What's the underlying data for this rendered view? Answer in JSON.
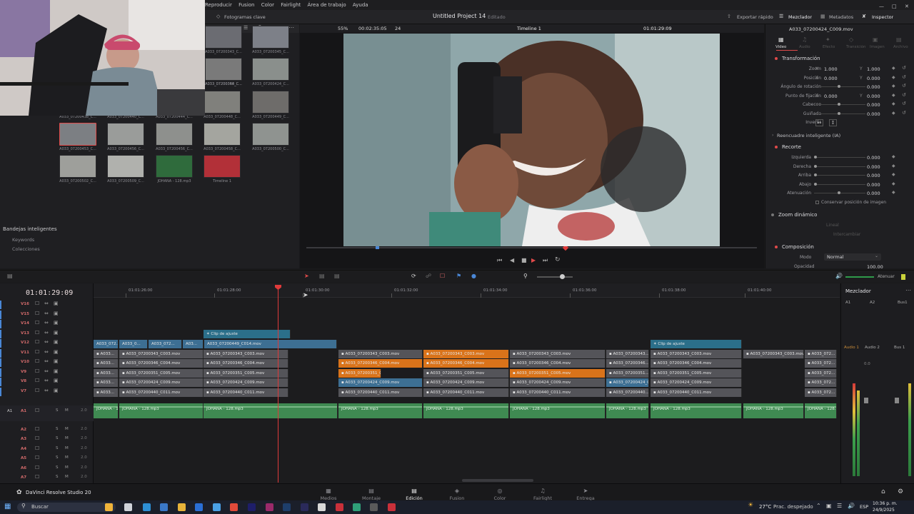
{
  "menu": {
    "items": [
      "Reproducir",
      "Fusion",
      "Color",
      "Fairlight",
      "Área de trabajo",
      "Ayuda"
    ]
  },
  "toolbar": {
    "keyframes_label": "Fotogramas clave",
    "project_title": "Untitled Project 14",
    "project_status": "Editado",
    "quick_export": "Exportar rápido",
    "mixer": "Mezclador",
    "metadata": "Metadatos",
    "inspector": "Inspector"
  },
  "viewer": {
    "zoom": "55%",
    "timecode_in": "00:02:35:05",
    "frame_rate": "24",
    "timeline_name": "Timeline 1",
    "timecode_out": "01:01:29:09"
  },
  "media_pool": {
    "clips": [
      {
        "label": "A033_07200343_C...",
        "color": "#6b6c72"
      },
      {
        "label": "A033_07200345_C...",
        "color": "#7d8088"
      },
      {
        "label": "A033_07200354_C...",
        "color": "#5e6270"
      },
      {
        "label": "A033_07200348_C...",
        "color": "#7a7a7a"
      },
      {
        "label": "A033_07200424_C...",
        "color": "#8a8f8c"
      },
      {
        "label": "A033_07200438_C...",
        "color": "#777b78"
      },
      {
        "label": "A033_07200440_C...",
        "color": "#85888a"
      },
      {
        "label": "A033_07200444_C...",
        "color": "#6f7171"
      },
      {
        "label": "A033_07200448_C...",
        "color": "#80807c"
      },
      {
        "label": "A033_07200449_C...",
        "color": "#6e6c6a"
      },
      {
        "label": "A033_07200453_C...",
        "color": "#7c7f83"
      },
      {
        "label": "A033_07200456_C...",
        "color": "#9a9c9a"
      },
      {
        "label": "A033_07200456_C...",
        "color": "#8e908d"
      },
      {
        "label": "A033_07200458_C...",
        "color": "#a4a59f"
      },
      {
        "label": "A033_07200500_C...",
        "color": "#8f9390"
      },
      {
        "label": "A033_07200502_C...",
        "color": "#9e9f9b"
      },
      {
        "label": "A033_07200509_C...",
        "color": "#b0b1ad"
      },
      {
        "label": "JOHANA - 128.mp3",
        "color": "#2f6b3c"
      },
      {
        "label": "Timeline 1",
        "color": "#b23038"
      }
    ],
    "smart_bins_title": "Bandejas inteligentes",
    "smart_bins": [
      "Keywords",
      "Colecciones"
    ]
  },
  "inspector": {
    "clip_name": "A033_07200424_C009.mov",
    "tabs": [
      "Video",
      "Audio",
      "Efecto",
      "Transición",
      "Imagen",
      "Archivo"
    ],
    "transform_title": "Transformación",
    "rows": [
      {
        "label": "Zoom",
        "x": "1.000",
        "y": "1.000"
      },
      {
        "label": "Posición",
        "x": "0.000",
        "y": "0.000"
      },
      {
        "label": "Ángulo de rotación",
        "x": "",
        "y": "0.000"
      },
      {
        "label": "Punto de fijación",
        "x": "0.000",
        "y": "0.000"
      },
      {
        "label": "Cabeceo",
        "x": "",
        "y": "0.000"
      },
      {
        "label": "Guiñada",
        "x": "",
        "y": "0.000"
      },
      {
        "label": "Invertir",
        "x": "",
        "y": ""
      }
    ],
    "smart_reframe": "Reencuadre inteligente (IA)",
    "crop_title": "Recorte",
    "crop_rows": [
      {
        "label": "Izquierda",
        "value": "0.000"
      },
      {
        "label": "Derecha",
        "value": "0.000"
      },
      {
        "label": "Arriba",
        "value": "0.000"
      },
      {
        "label": "Abajo",
        "value": "0.000"
      },
      {
        "label": "Atenuación",
        "value": "0.000"
      }
    ],
    "keep_image_position": "Conservar posición de imagen",
    "dynamic_zoom_title": "Zoom dinámico",
    "dynamic_zoom_mode": "Lineal",
    "dynamic_zoom_swap": "Intercambiar",
    "composite_title": "Composición",
    "mode_label": "Modo",
    "mode_value": "Normal",
    "opacity_label": "Opacidad",
    "opacity_value": "100.00"
  },
  "timeline": {
    "timecode": "01:01:29:09",
    "ruler_ticks": [
      "01:01:26:00",
      "01:01:28:00",
      "01:01:30:00",
      "01:01:32:00",
      "01:01:34:00",
      "01:01:36:00",
      "01:01:38:00",
      "01:01:40:00"
    ],
    "video_tracks": [
      "V16",
      "V15",
      "V14",
      "V13",
      "V12",
      "V11",
      "V10",
      "V9",
      "V8",
      "V7"
    ],
    "audio_tracks": [
      "A1",
      "A2",
      "A3",
      "A4",
      "A5",
      "A6",
      "A7"
    ],
    "audio_track_level": "2.0",
    "adjustment_clip_label": "Clip de ajuste",
    "v12_clips": [
      "A033_072...",
      "A033_0...",
      "A033_072...",
      "A03...",
      "A033_07200449_C014.mov"
    ],
    "v11_clips": [
      "A033...",
      "A033_07200343_C003.mov",
      "A033_07200343_C003.mov",
      "A033_07200343_C003.mov",
      "A033_07200343_C003.mov",
      "A033_07200343_C003.mov",
      "A033_07200343...",
      "A033_07200343_C003.mov",
      "A033_07200343_C003.mov",
      "A033_072..."
    ],
    "v10_clips": [
      "A033...",
      "A033_07200346_C004.mov",
      "A033_07200346_C004.mov",
      "A033_07200346_C004.mov",
      "A033_07200346_C004.mov",
      "A033_07200346_C004.mov",
      "A033_07200346...",
      "A033_07200346_C004.mov",
      "A033_072..."
    ],
    "v9_clips": [
      "A033...",
      "A033_07200351_C005.mov",
      "A033_07200351_C005.mov",
      "A033_07200351_C0...",
      "A033_07200351_C005.mov",
      "A033_07200351_C005.mov",
      "A033_07200351...",
      "A033_07200351_C005.mov",
      "A033_072..."
    ],
    "v8_clips": [
      "A033...",
      "A033_07200424_C009.mov",
      "A033_07200424_C009.mov",
      "A033_07200424_C009.mov",
      "A033_07200424_C009.mov",
      "A033_07200424_C009.mov",
      "A033_07200424_C00...",
      "A033_07200424_C009.mov",
      "A033_072..."
    ],
    "v7_clips": [
      "A033...",
      "A033_07200440_C011.mov",
      "A033_07200440_C011.mov",
      "A033_07200440_C011.mov",
      "A033_07200440_C011.mov",
      "A033_07200440_C011.mov",
      "A033_07200440...",
      "A033_07200440_C011.mov",
      "A033_072..."
    ],
    "audio_clip_label": "JOHANA - 128.mp3",
    "audio_clip_short": "JOHANA - 1..."
  },
  "mixer": {
    "title": "Mezclador",
    "channels": [
      "A1",
      "A2",
      "Bus1"
    ],
    "row2": [
      "Audio 1",
      "Audio 2",
      "Bus 1"
    ],
    "level": "0.0",
    "mute_label": "Atenuar"
  },
  "pages": {
    "app_name": "DaVinci Resolve Studio 20",
    "tabs": [
      "Medios",
      "Montaje",
      "Edición",
      "Fusion",
      "Color",
      "Fairlight",
      "Entrega"
    ],
    "active": "Edición"
  },
  "taskbar": {
    "search_placeholder": "Buscar",
    "weather_temp": "27°C",
    "weather_desc": "Prac. despejado",
    "lang": "ESP",
    "time": "10:36 p. m.",
    "date": "24/9/2025"
  },
  "colors": {
    "accent_red": "#e04a4a",
    "clip_orange": "#d9731a",
    "audio_green": "#3f8a52",
    "playhead": "#e03a3a"
  }
}
